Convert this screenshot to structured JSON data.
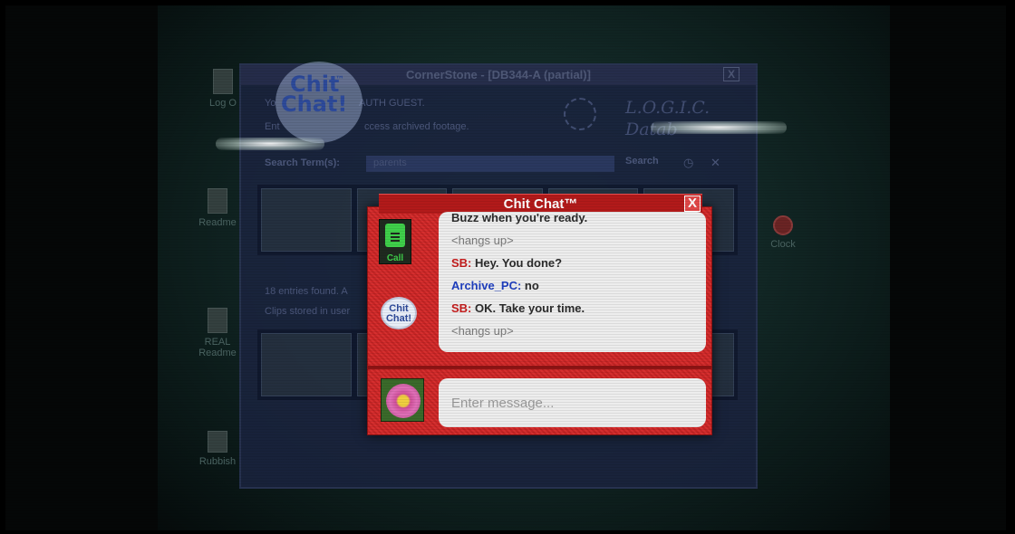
{
  "background_window": {
    "title": "CornerStone - [DB344-A (partial)]",
    "welcome_prefix": "Yo",
    "welcome_user": "AUTH GUEST.",
    "instruction_prefix": "Ent",
    "instruction_suffix": "ccess archived footage.",
    "brand_line1": "L.O.G.I.C.",
    "brand_line2": "Datab",
    "search_label": "Search Term(s):",
    "search_value": "parents",
    "search_button": "Search",
    "results_text": "18 entries found. A",
    "stored_text": "Clips stored in user",
    "close_glyph": "X"
  },
  "desktop": {
    "icons": [
      {
        "label": "Log O",
        "icon": "log-out-icon"
      },
      {
        "label": "Readme",
        "icon": "document-icon"
      },
      {
        "label": "REAL",
        "icon": "document-icon"
      },
      {
        "label": "Readme",
        "icon": "document-icon"
      },
      {
        "label": "Rubbish",
        "icon": "trash-icon"
      },
      {
        "label": "Clock",
        "icon": "clock-icon"
      }
    ]
  },
  "logo": {
    "word1": "Chit",
    "word2": "Chat!",
    "tm": "™"
  },
  "dialog": {
    "title": "Chit Chat™",
    "close": "X",
    "call_label": "Call",
    "badge_word1": "Chit",
    "badge_word2": "Chat!",
    "messages": [
      {
        "speaker": "",
        "text": "Buzz when you're ready.",
        "type": "plain"
      },
      {
        "speaker": "",
        "text": "<hangs up>",
        "type": "sys"
      },
      {
        "speaker": "SB:",
        "text": " Hey. You done?",
        "type": "sb"
      },
      {
        "speaker": "Archive_PC:",
        "text": " no",
        "type": "pc"
      },
      {
        "speaker": "SB:",
        "text": " OK. Take your time.",
        "type": "sb"
      },
      {
        "speaker": "",
        "text": "<hangs up>",
        "type": "sys"
      }
    ],
    "input_placeholder": "Enter message...",
    "input_value": ""
  },
  "colors": {
    "dialog_red": "#d62f2f",
    "speaker_sb": "#c41c1c",
    "speaker_pc": "#1f3fbf",
    "call_green": "#3fcf4a"
  }
}
